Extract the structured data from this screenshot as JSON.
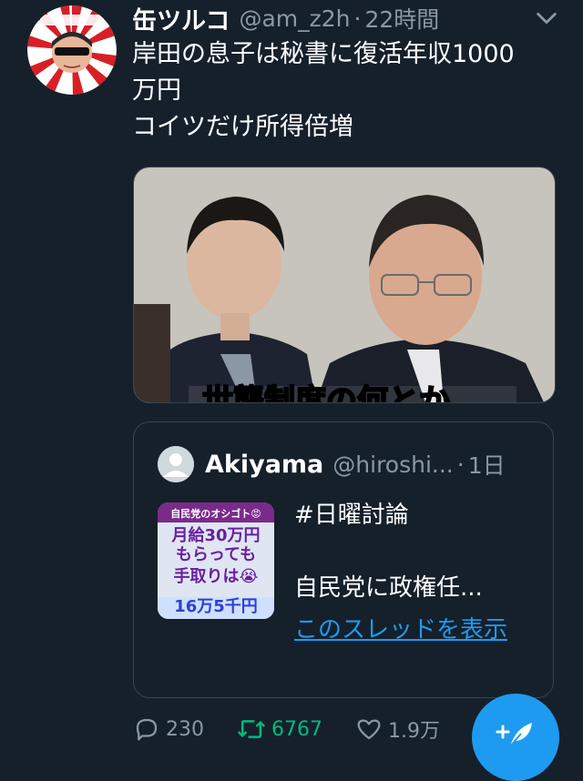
{
  "tweet": {
    "display_name": "缶ツルコ",
    "handle": "@am_z2h",
    "separator": "·",
    "time": "22時間",
    "text": "岸田の息子は秘書に復活年収1000\n万円\nコイツだけ所得倍増",
    "media_caption_fragment": "世襲制度の何とか"
  },
  "quote": {
    "display_name": "Akiyama",
    "handle": "@hiroshi...",
    "separator": "·",
    "time": "1日",
    "text": "#日曜討論\n\n自民党に政権任...",
    "show_thread": "このスレッドを表示",
    "thumb": {
      "line1": "自民党のオシゴト😡",
      "line2": "月給30万円",
      "line3": "もらっても",
      "line4": "手取りは😭",
      "line5": "16万5千円"
    }
  },
  "actions": {
    "reply_count": "230",
    "retweet_count": "6767",
    "like_count": "1.9万"
  },
  "colors": {
    "background": "#15202b",
    "secondary_text": "#8b98a5",
    "accent": "#1d9bf0",
    "retweet": "#00ba7c"
  }
}
